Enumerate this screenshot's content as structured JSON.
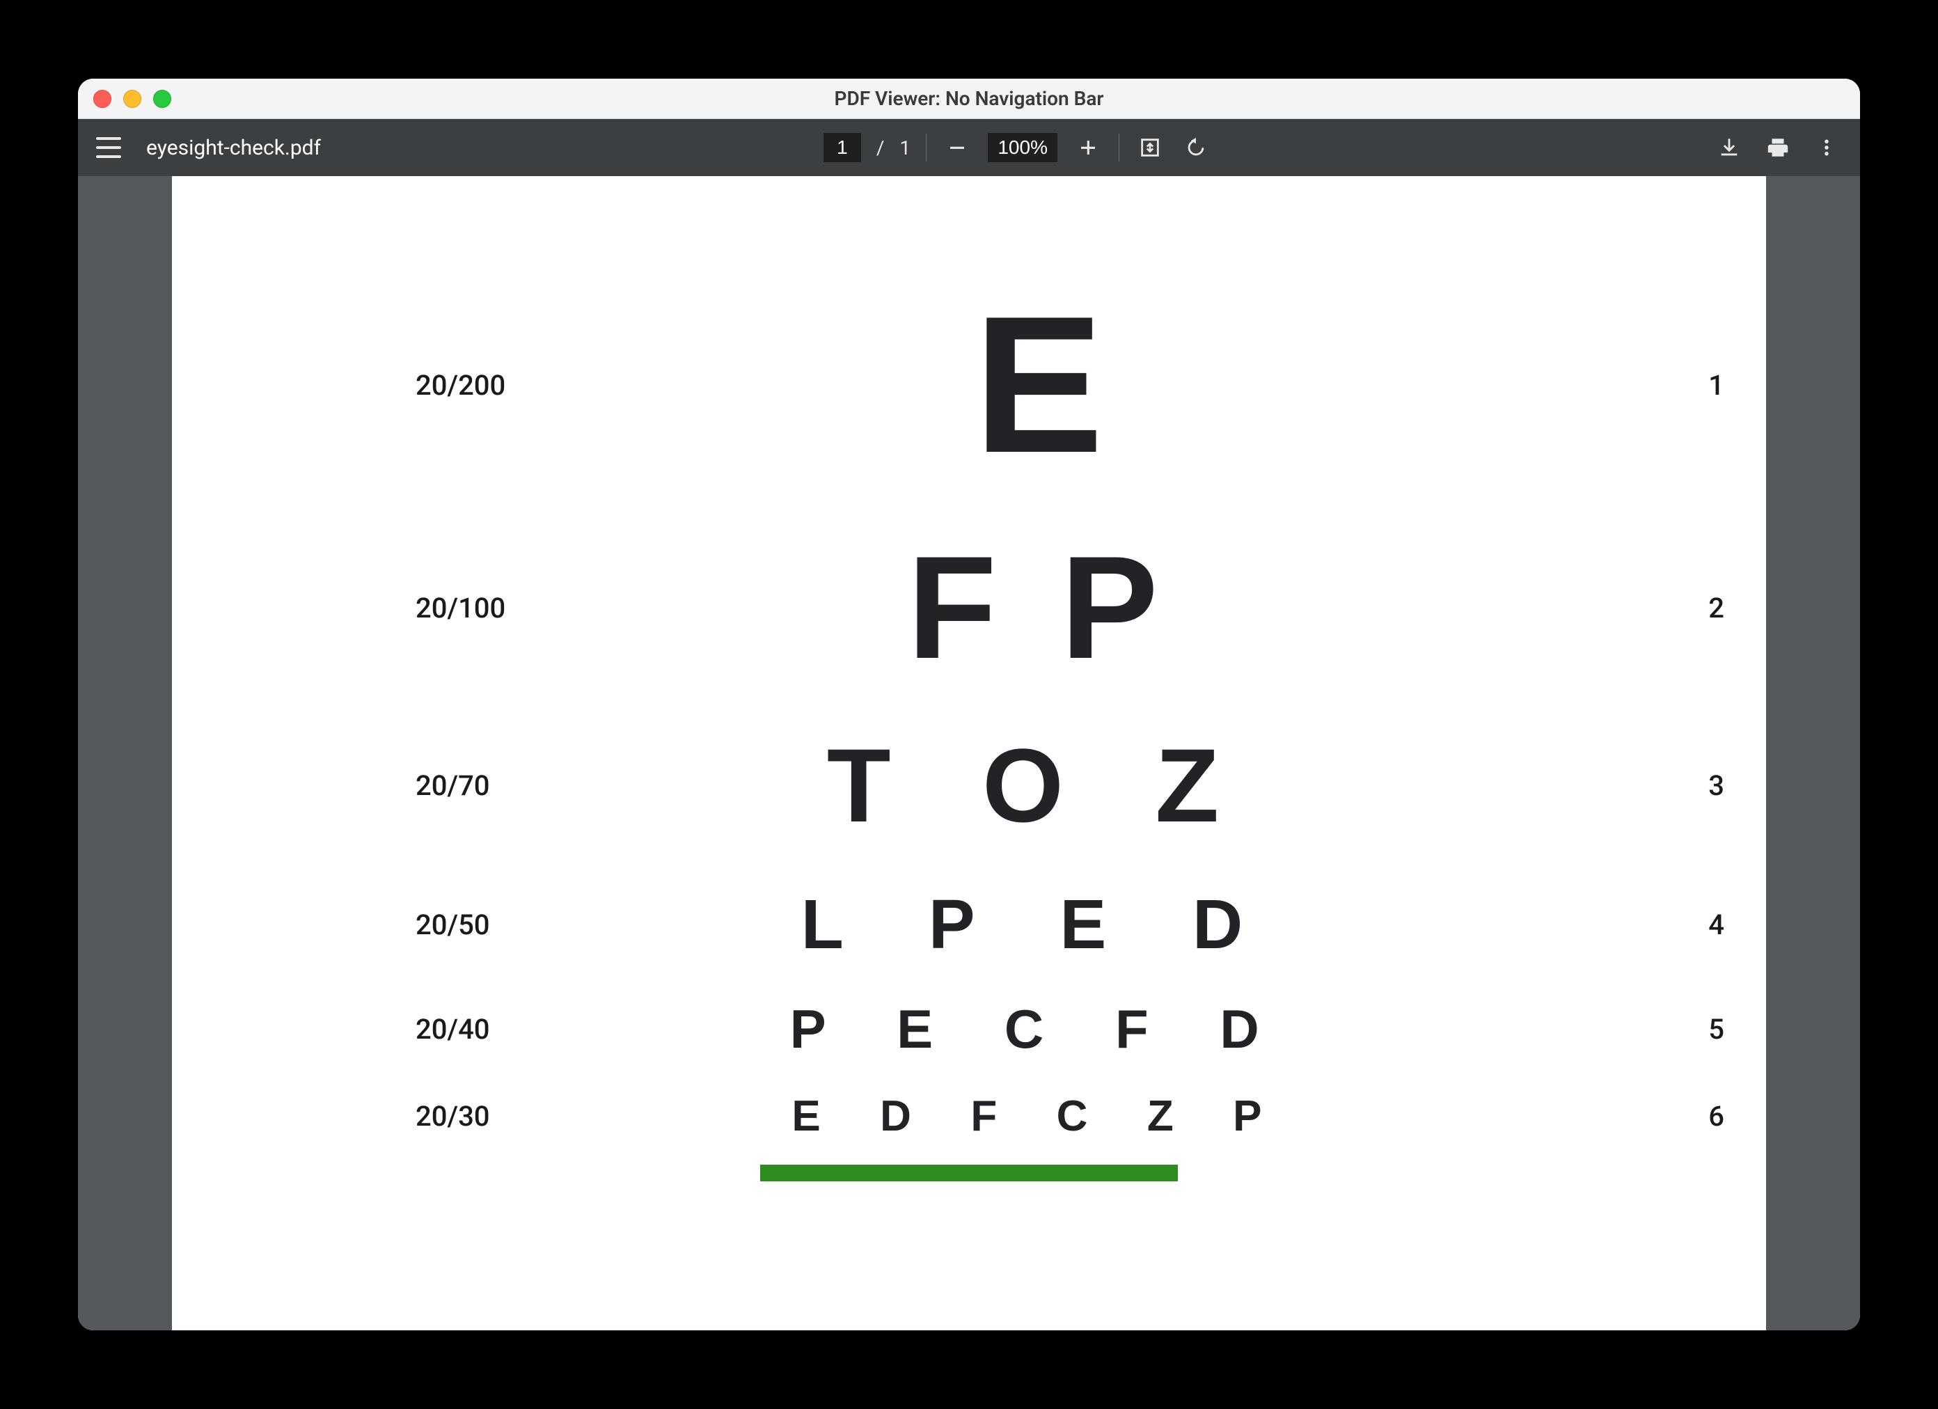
{
  "window": {
    "title": "PDF Viewer: No Navigation Bar"
  },
  "toolbar": {
    "filename": "eyesight-check.pdf",
    "page_current": "1",
    "page_separator": "/",
    "page_total": "1",
    "zoom_value": "100%"
  },
  "document": {
    "rows": [
      {
        "acuity": "20/200",
        "letters": "E",
        "line": "1"
      },
      {
        "acuity": "20/100",
        "letters": "F P",
        "line": "2"
      },
      {
        "acuity": "20/70",
        "letters": "T O Z",
        "line": "3"
      },
      {
        "acuity": "20/50",
        "letters": "L P E D",
        "line": "4"
      },
      {
        "acuity": "20/40",
        "letters": "P E C F D",
        "line": "5"
      },
      {
        "acuity": "20/30",
        "letters": "E D F C Z P",
        "line": "6"
      }
    ],
    "green_bar_color": "#2f8d1f"
  }
}
